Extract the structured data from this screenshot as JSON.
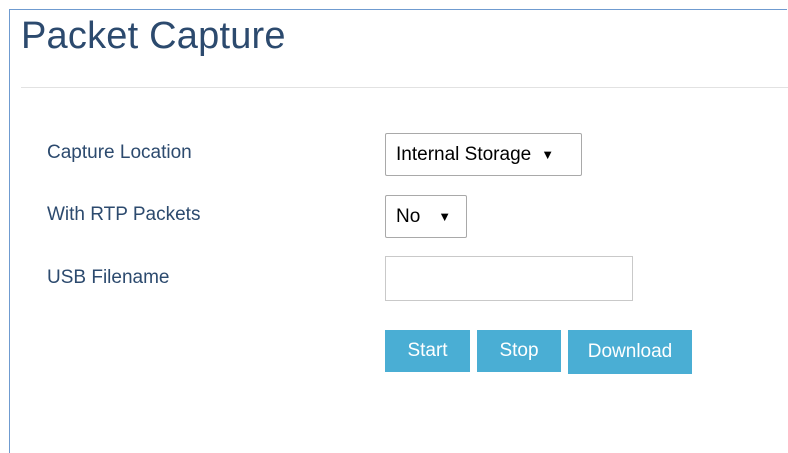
{
  "page": {
    "title": "Packet Capture"
  },
  "form": {
    "capture_location": {
      "label": "Capture Location",
      "value": "Internal Storage"
    },
    "with_rtp_packets": {
      "label": "With RTP Packets",
      "value": "No"
    },
    "usb_filename": {
      "label": "USB Filename",
      "value": "",
      "placeholder": ""
    }
  },
  "buttons": {
    "start": "Start",
    "stop": "Stop",
    "download": "Download"
  },
  "icons": {
    "dropdown": "triangle-down"
  },
  "colors": {
    "title": "#2c4a6e",
    "label": "#2c4a6e",
    "button_bg": "#4aaed4",
    "button_text": "#ffffff",
    "frame_border": "#6f9bd0"
  }
}
